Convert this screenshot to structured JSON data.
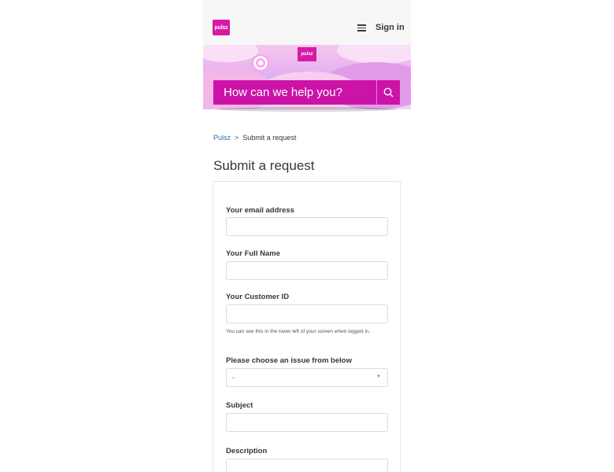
{
  "header": {
    "logo_text": "pulsz",
    "menu_icon": "hamburger-icon",
    "signin_label": "Sign in"
  },
  "hero": {
    "logo_text": "pulsz",
    "search_placeholder": "How can we help you?",
    "search_icon": "search-icon"
  },
  "breadcrumb": {
    "home": "Pulsz",
    "separator": ">",
    "current": "Submit a request"
  },
  "page": {
    "title": "Submit a request"
  },
  "form": {
    "email_label": "Your email address",
    "fullname_label": "Your Full Name",
    "customer_id_label": "Your Customer ID",
    "customer_id_hint": "You can see this in the lower left of your screen when logged in.",
    "issue_label": "Please choose an issue from below",
    "issue_selected": "-",
    "subject_label": "Subject",
    "description_label": "Description"
  },
  "colors": {
    "brand": "#d71aa6",
    "search_bar": "#cc13a8",
    "link": "#1f73b7"
  }
}
